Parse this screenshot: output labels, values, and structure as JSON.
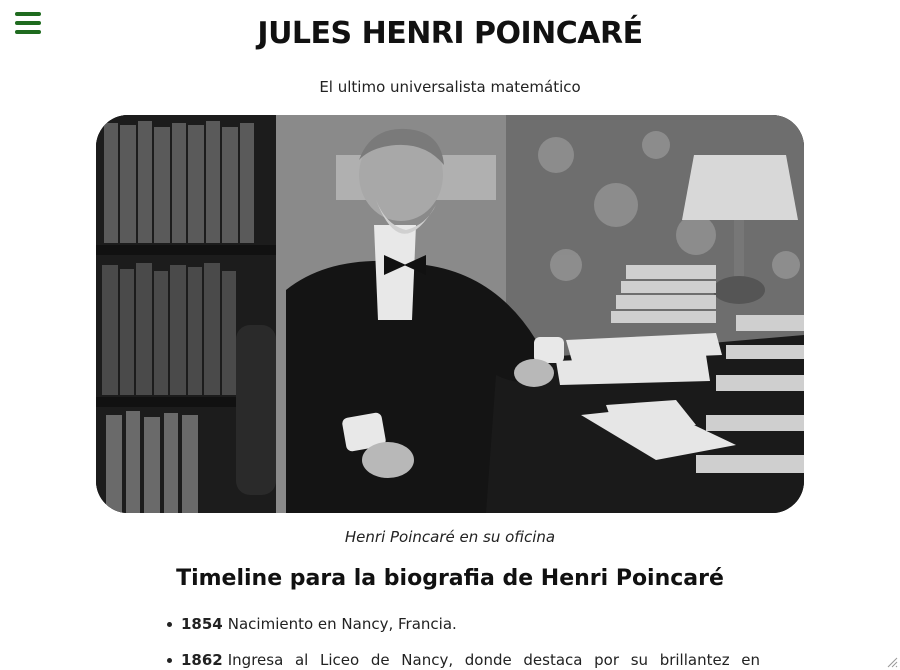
{
  "header": {
    "title": "JULES HENRI POINCARÉ",
    "subtitle": "El ultimo universalista matemático"
  },
  "menu": {
    "icon": "hamburger-menu-icon",
    "color": "#1f6b1f"
  },
  "photo": {
    "caption": "Henri Poincaré en su oficina"
  },
  "timeline": {
    "heading": "Timeline para la biografia de Henri Poincaré",
    "items": [
      {
        "year": "1854",
        "text": "Nacimiento en Nancy, Francia."
      },
      {
        "year": "1862",
        "text": "Ingresa al Liceo de Nancy, donde destaca por su brillantez en"
      }
    ]
  }
}
